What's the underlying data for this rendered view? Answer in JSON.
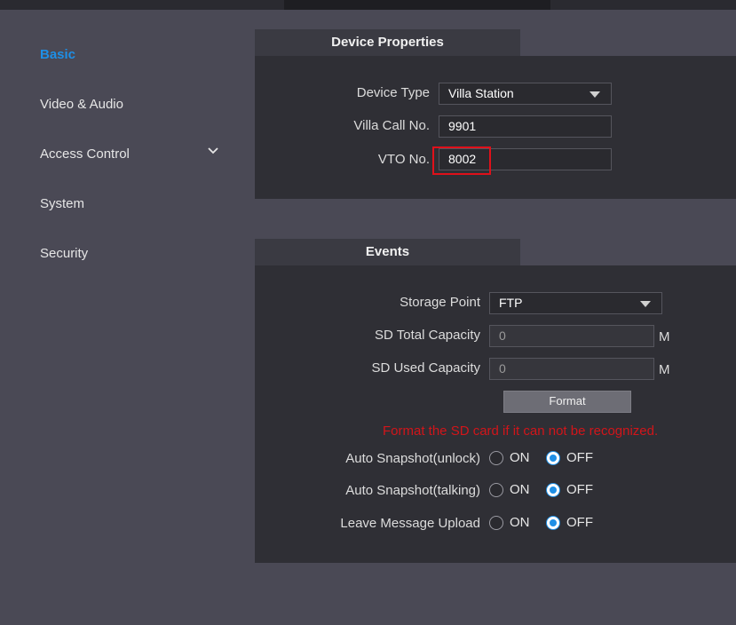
{
  "sidebar": {
    "items": [
      {
        "label": "Basic",
        "active": true
      },
      {
        "label": "Video & Audio"
      },
      {
        "label": "Access Control",
        "expandable": true
      },
      {
        "label": "System"
      },
      {
        "label": "Security"
      }
    ]
  },
  "device_properties": {
    "title": "Device Properties",
    "device_type_label": "Device Type",
    "device_type_value": "Villa Station",
    "villa_call_label": "Villa Call No.",
    "villa_call_value": "9901",
    "vto_label": "VTO No.",
    "vto_value": "8002"
  },
  "events": {
    "title": "Events",
    "storage_point_label": "Storage Point",
    "storage_point_value": "FTP",
    "sd_total_label": "SD Total Capacity",
    "sd_total_value": "0",
    "sd_used_label": "SD Used Capacity",
    "sd_used_value": "0",
    "unit": "M",
    "format_button": "Format",
    "format_warning": "Format the SD card if it can not be recognized.",
    "on_label": "ON",
    "off_label": "OFF",
    "options": [
      {
        "label": "Auto Snapshot(unlock)",
        "value": "OFF"
      },
      {
        "label": "Auto Snapshot(talking)",
        "value": "OFF"
      },
      {
        "label": "Leave Message Upload",
        "value": "OFF"
      }
    ]
  },
  "colors": {
    "accent": "#1e8fe6",
    "warning": "#d2151a",
    "highlight_box": "#e0101a"
  },
  "icons": {
    "access_control_chevron": "chevron-down-icon",
    "select_arrow": "caret-down-icon"
  }
}
